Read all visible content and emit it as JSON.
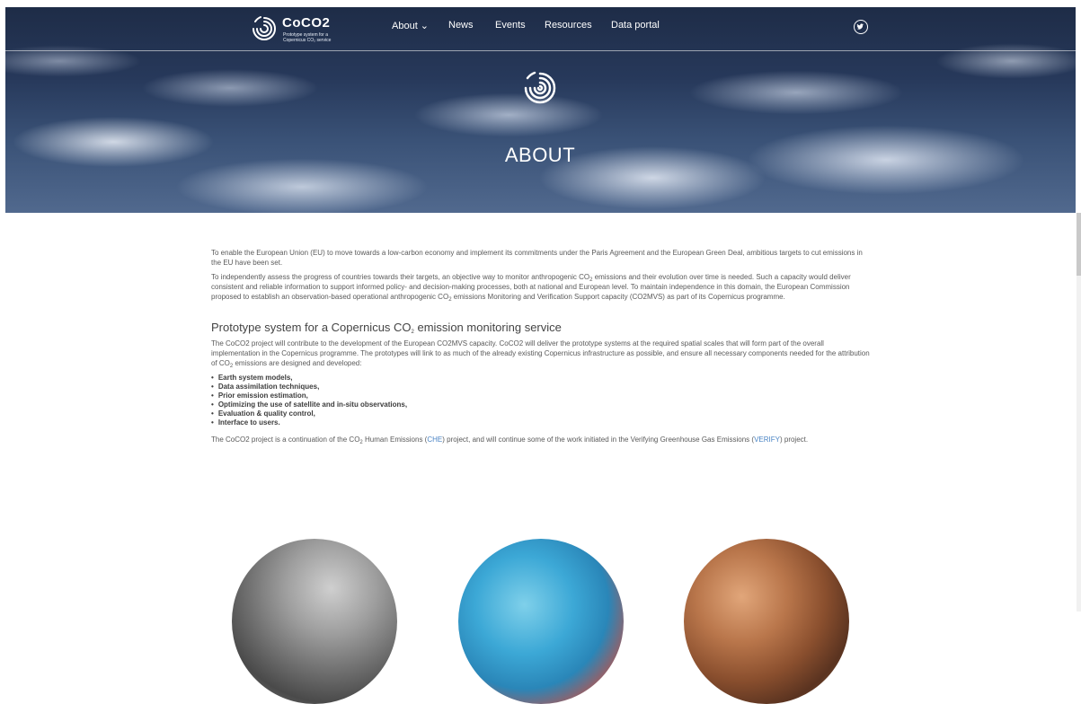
{
  "header": {
    "logo_title": "CoCO2",
    "logo_subtitle": "Prototype system for a Copernicus CO₂ service",
    "nav": [
      {
        "label": "About ⌄"
      },
      {
        "label": "News"
      },
      {
        "label": "Events"
      },
      {
        "label": "Resources"
      },
      {
        "label": "Data portal"
      }
    ]
  },
  "hero": {
    "title": "ABOUT"
  },
  "content": {
    "p1": "To enable the European Union (EU) to move towards a low-carbon economy and implement its commitments under the Paris Agreement and the European Green Deal, ambitious targets to cut emissions in the EU have been set.",
    "p2_a": "To independently assess the progress of countries towards their targets, an objective way to monitor anthropogenic CO",
    "p2_b": " emissions and their evolution over time is needed. Such a capacity would deliver consistent and reliable information to support informed policy- and decision-making processes, both at national and European level. To maintain independence in this domain, the European Commission proposed to establish an observation-based operational anthropogenic CO",
    "p2_c": " emissions Monitoring and Verification Support capacity (CO2MVS) as part of its Copernicus programme.",
    "heading_a": "Prototype system for a Copernicus CO",
    "heading_b": " emission monitoring service",
    "p3_a": "The CoCO2  project will contribute to the development of the European CO2MVS capacity. CoCO2 will deliver the prototype systems  at the required spatial scales that will form part of the overall implementation in the Copernicus programme. The prototypes will link to as much of the already existing Copernicus infrastructure as possible, and  ensure all necessary components needed for the attribution of CO",
    "p3_b": " emissions are designed and developed:",
    "bullets": [
      "Earth system models,",
      "Data assimilation techniques,",
      "Prior emission estimation,",
      "Optimizing the use of satellite and in-situ observations,",
      "Evaluation & quality control,",
      "Interface to users."
    ],
    "p4_a": "The CoCO2 project is a continuation of the CO",
    "p4_b": " Human Emissions (",
    "link_che": "CHE",
    "p4_c": ") project, and  will continue some of the work initiated in the Verifying Greenhouse Gas Emissions (",
    "link_verify": "VERIFY",
    "p4_d": ") project.",
    "sub2": "2"
  }
}
